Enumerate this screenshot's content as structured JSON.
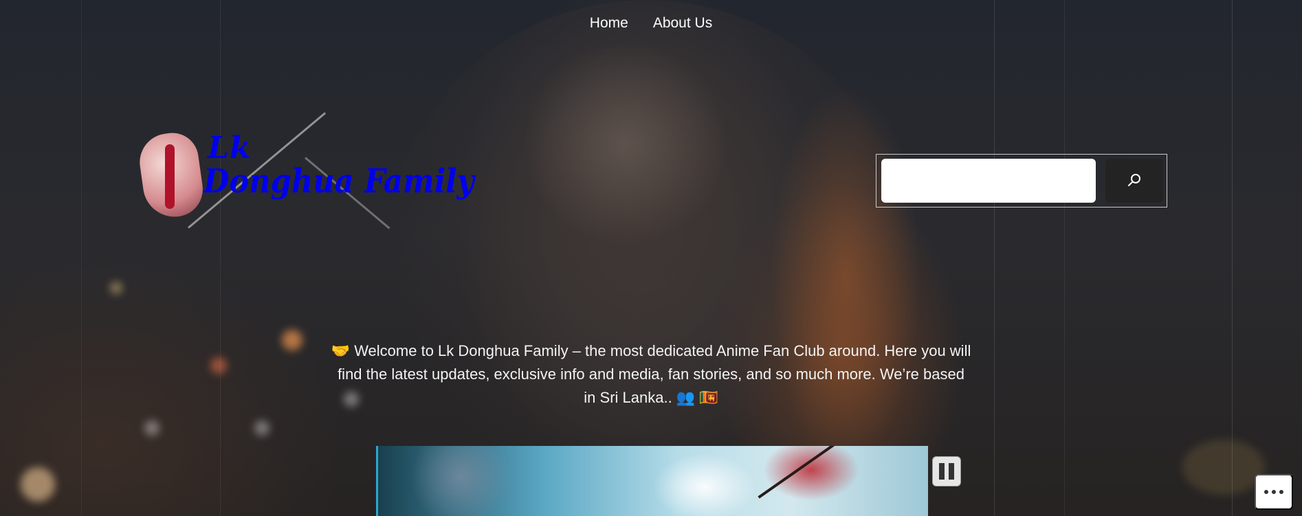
{
  "nav": {
    "items": [
      {
        "label": "Home"
      },
      {
        "label": "About Us"
      }
    ]
  },
  "logo": {
    "line1": "Lk",
    "line2": "Donghua Family"
  },
  "search": {
    "value": "",
    "placeholder": "",
    "button_icon": "search-icon"
  },
  "welcome": {
    "emoji_start": "🤝",
    "text": "Welcome to Lk Donghua Family – the most dedicated Anime Fan Club around. Here you will find the latest updates, exclusive info and media, fan stories, and so much more. We’re based in Sri Lanka..",
    "emoji_end": "👥 🇱🇰"
  },
  "media": {
    "pause_icon": "pause-icon"
  },
  "more": {
    "icon": "ellipsis-icon"
  },
  "colors": {
    "accent": "#2aa7d2",
    "text": "#ffffff"
  }
}
